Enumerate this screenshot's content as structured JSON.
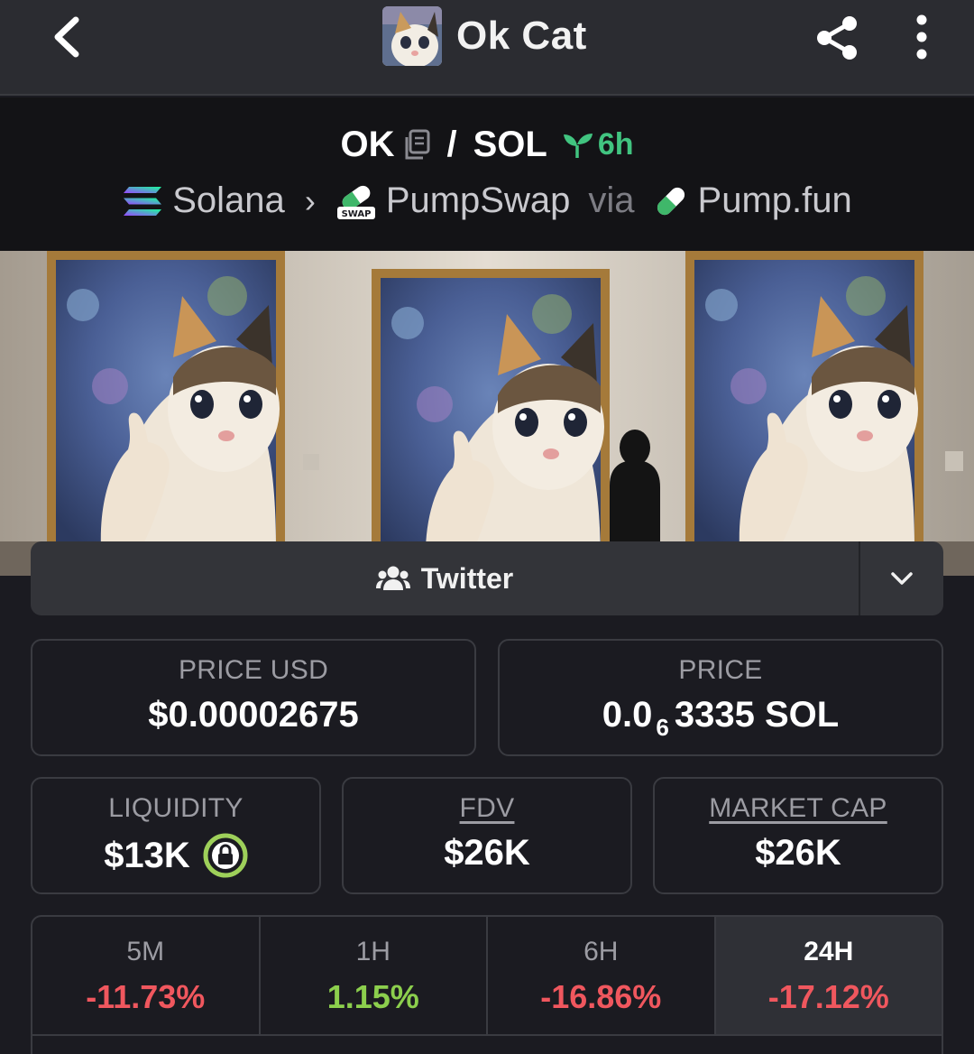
{
  "appbar": {
    "title": "Ok Cat",
    "icons": {
      "back": "chevron-left-icon",
      "share": "share-icon",
      "more": "more-vertical-icon"
    }
  },
  "pair": {
    "base": "OK",
    "separator": "/",
    "quote": "SOL",
    "age": "6h",
    "chain": "Solana",
    "dex": "PumpSwap",
    "dex_badge": "SWAP",
    "via_label": "via",
    "launchpad": "Pump.fun"
  },
  "socials": {
    "twitter_label": "Twitter"
  },
  "stats": {
    "price_usd_label": "PRICE USD",
    "price_usd": "$0.00002675",
    "price_label": "PRICE",
    "price_native_prefix": "0.0",
    "price_native_zeros": "6",
    "price_native_suffix": "3335 SOL",
    "liquidity_label": "LIQUIDITY",
    "liquidity": "$13K",
    "fdv_label": "FDV",
    "fdv": "$26K",
    "mcap_label": "MARKET CAP",
    "mcap": "$26K"
  },
  "timeframes": [
    {
      "label": "5M",
      "value": "-11.73%",
      "color": "#f0575e"
    },
    {
      "label": "1H",
      "value": "1.15%",
      "color": "#8ccf4d"
    },
    {
      "label": "6H",
      "value": "-16.86%",
      "color": "#f0575e"
    },
    {
      "label": "24H",
      "value": "-17.12%",
      "color": "#f0575e",
      "active": true
    }
  ],
  "colors": {
    "positive": "#8ccf4d",
    "negative": "#f0575e",
    "age_green": "#41c480",
    "lock_green": "#9ed05a"
  }
}
